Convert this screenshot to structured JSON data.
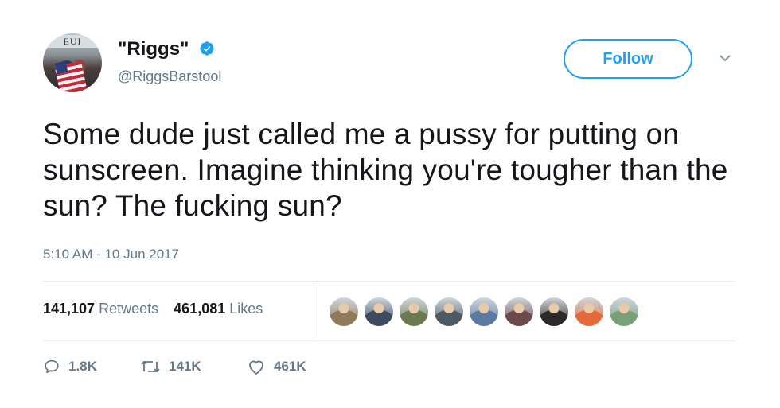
{
  "author": {
    "display_name": "\"Riggs\"",
    "handle": "@RiggsBarstool",
    "avatar_sign_text": "EUI"
  },
  "follow_label": "Follow",
  "tweet": {
    "text": "Some dude just called me a pussy for putting on sunscreen. Imagine thinking you're tougher than the sun? The fucking sun?",
    "timestamp": "5:10 AM - 10 Jun 2017"
  },
  "stats": {
    "retweets_count": "141,107",
    "retweets_label": "Retweets",
    "likes_count": "461,081",
    "likes_label": "Likes"
  },
  "likers": [
    {
      "name": "liker-avatar-1",
      "color": "#8f7a5a"
    },
    {
      "name": "liker-avatar-2",
      "color": "#3c4b5e"
    },
    {
      "name": "liker-avatar-3",
      "color": "#6c7a52"
    },
    {
      "name": "liker-avatar-4",
      "color": "#4d5a66"
    },
    {
      "name": "liker-avatar-5",
      "color": "#5a7aa0"
    },
    {
      "name": "liker-avatar-6",
      "color": "#6a4a4a"
    },
    {
      "name": "liker-avatar-7",
      "color": "#2e2a2a"
    },
    {
      "name": "liker-avatar-8",
      "color": "#e56a3a"
    },
    {
      "name": "liker-avatar-9",
      "color": "#7aa07a"
    }
  ],
  "actions": {
    "replies": "1.8K",
    "retweets": "141K",
    "likes": "461K"
  },
  "colors": {
    "accent": "#1da1f2",
    "text": "#14171a",
    "secondary": "#657786",
    "divider": "#e6ecf0"
  }
}
